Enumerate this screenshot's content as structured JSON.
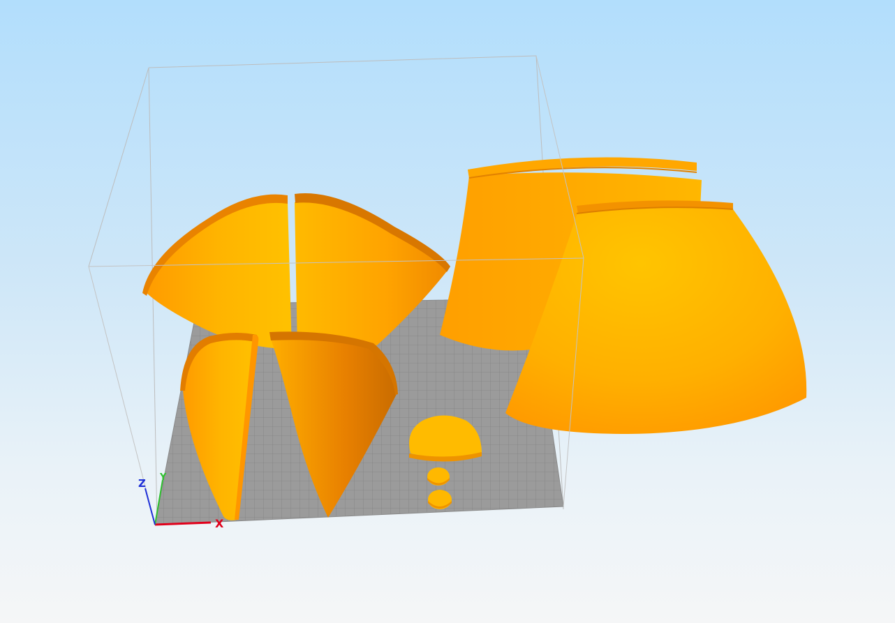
{
  "viewport": {
    "background_top": "#b2defc",
    "background_bottom": "#f5f6f7"
  },
  "colors": {
    "part_light": "#ffbe00",
    "part_mid": "#ffa800",
    "part_dark": "#e27d00",
    "bed": "#9b9b9b",
    "bed_grid": "#7f7f7f",
    "build_volume": "#b9b9b9",
    "axis_x": "#e0001b",
    "axis_y": "#2ec02e",
    "axis_z": "#1e2fd7"
  },
  "axes": {
    "x_label": "X",
    "y_label": "Y",
    "z_label": "Z"
  },
  "objects": [
    "petal-top-left",
    "petal-top-right",
    "petal-bottom-left",
    "petal-bottom-right",
    "shade-back",
    "shade-front",
    "mushroom-cap",
    "disc-small-1",
    "disc-small-2"
  ]
}
